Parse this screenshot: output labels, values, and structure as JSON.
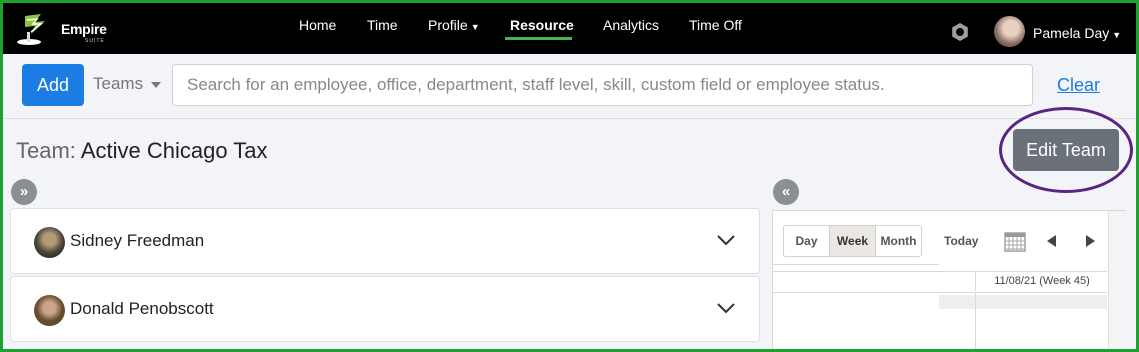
{
  "brand": {
    "name": "Empire",
    "sub": "SUITE"
  },
  "nav": {
    "items": [
      {
        "label": "Home",
        "active": false
      },
      {
        "label": "Time",
        "active": false
      },
      {
        "label": "Profile",
        "active": false,
        "has_caret": true
      },
      {
        "label": "Resource",
        "active": true
      },
      {
        "label": "Analytics",
        "active": false
      },
      {
        "label": "Time Off",
        "active": false
      }
    ],
    "accent_color": "#4caf50"
  },
  "user": {
    "name": "Pamela Day",
    "icon": "avatar"
  },
  "settings_icon": "gear-icon",
  "toolbar": {
    "add_label": "Add",
    "filter_label": "Teams",
    "search_placeholder": "Search for an employee, office, department, staff level, skill, custom field or employee status.",
    "search_value": "",
    "clear_label": "Clear"
  },
  "team": {
    "prefix": "Team:",
    "name": "Active Chicago Tax",
    "edit_label": "Edit Team"
  },
  "panels": {
    "expand_icon": "double-chevron-right-icon",
    "collapse_icon": "double-chevron-left-icon"
  },
  "employees": [
    {
      "name": "Sidney Freedman",
      "icon": "chevron-down-icon"
    },
    {
      "name": "Donald Penobscott",
      "icon": "chevron-down-icon"
    }
  ],
  "calendar": {
    "views": [
      {
        "label": "Day",
        "active": false
      },
      {
        "label": "Week",
        "active": true
      },
      {
        "label": "Month",
        "active": false
      }
    ],
    "today_label": "Today",
    "week_header": "11/08/21 (Week 45)"
  },
  "colors": {
    "frame_border": "#1fa033",
    "primary": "#1b7de3",
    "highlight_ring": "#5b2482",
    "edit_button": "#6b7178"
  }
}
